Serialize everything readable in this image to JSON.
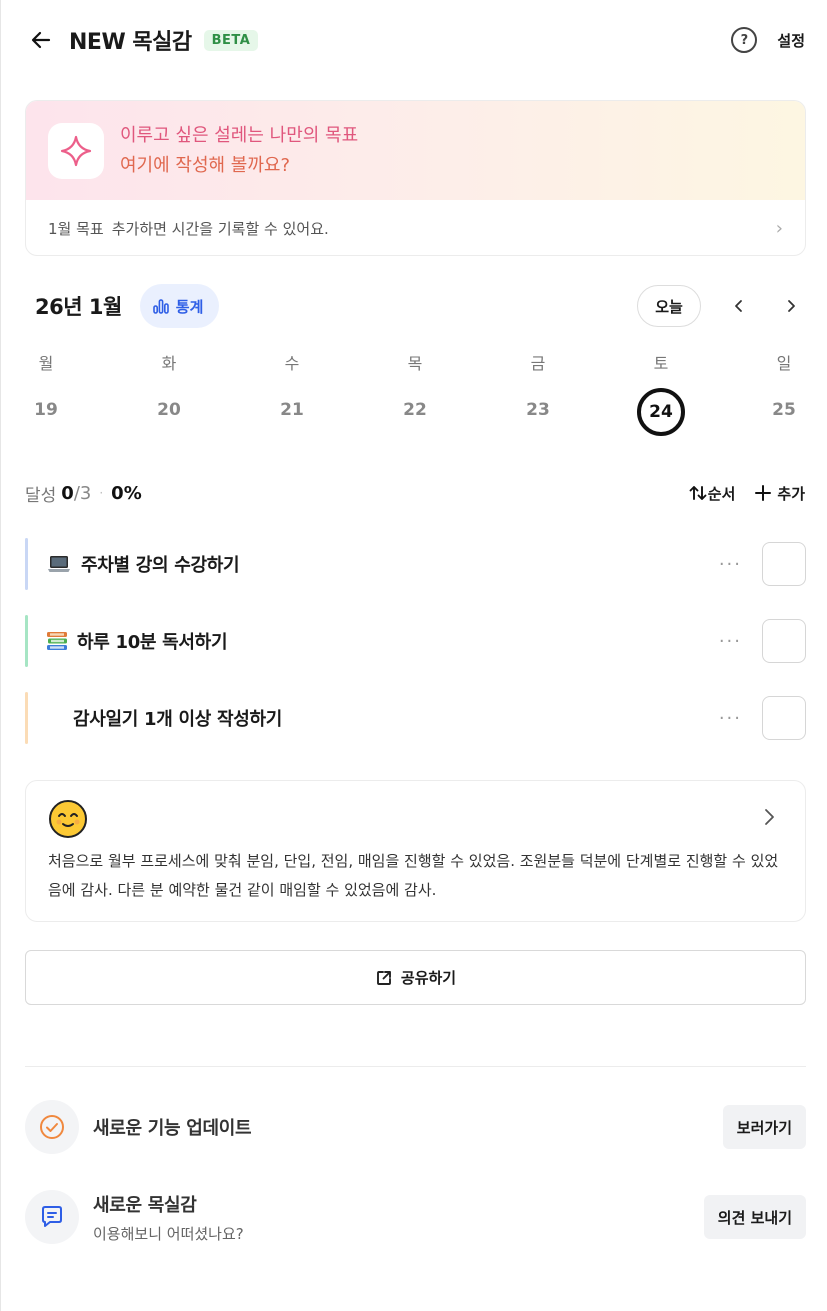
{
  "header": {
    "title": "NEW 목실감",
    "badge": "BETA",
    "help_symbol": "?",
    "settings_label": "설정"
  },
  "goal_card": {
    "line1": "이루고 싶은 설레는 나만의 목표",
    "line2": "여기에 작성해 볼까요?",
    "month_goal": "1월 목표",
    "hint": "추가하면 시간을 기록할 수 있어요.",
    "chevron": "›"
  },
  "calendar": {
    "month_label": "26년 1월",
    "stats_label": "통계",
    "today_label": "오늘",
    "weekdays": [
      "월",
      "화",
      "수",
      "목",
      "금",
      "토",
      "일"
    ],
    "dates": [
      "19",
      "20",
      "21",
      "22",
      "23",
      "24",
      "25"
    ],
    "selected_date": "24"
  },
  "achievement": {
    "label": "달성",
    "done": "0",
    "total": "/3",
    "separator": "·",
    "percent": "0%",
    "order_label": "순서",
    "add_label": "추가"
  },
  "tasks": [
    {
      "name": "주차별 강의 수강하기",
      "icon": "laptop-icon",
      "color": "#c9d7f5",
      "more": "···"
    },
    {
      "name": "하루 10분 독서하기",
      "icon": "books-icon",
      "color": "#a6e5c4",
      "more": "···"
    },
    {
      "name": "감사일기 1개 이상 작성하기",
      "icon": "",
      "color": "#fbdcb6",
      "more": "···"
    }
  ],
  "diary": {
    "emoji": "smiling-face-icon",
    "text": "처음으로 월부 프로세스에 맞춰 분임, 단입, 전임, 매임을 진행할 수 있었음. 조원분들 덕분에 단계별로 진행할 수 있었음에 감사. 다른 분 예약한 물건 같이 매임할 수 있었음에 감사."
  },
  "share": {
    "label": "공유하기"
  },
  "bottom": {
    "update": {
      "title": "새로운 기능 업데이트",
      "button": "보러가기"
    },
    "feedback": {
      "title": "새로운 목실감",
      "subtitle": "이용해보니 어떠셨나요?",
      "button": "의견 보내기"
    }
  },
  "colors": {
    "accent_blue": "#2e5ee6",
    "beta_green": "#2f8f46",
    "goal_pink": "#e0577d",
    "goal_orange": "#e0684f",
    "update_orange": "#f0883e"
  }
}
